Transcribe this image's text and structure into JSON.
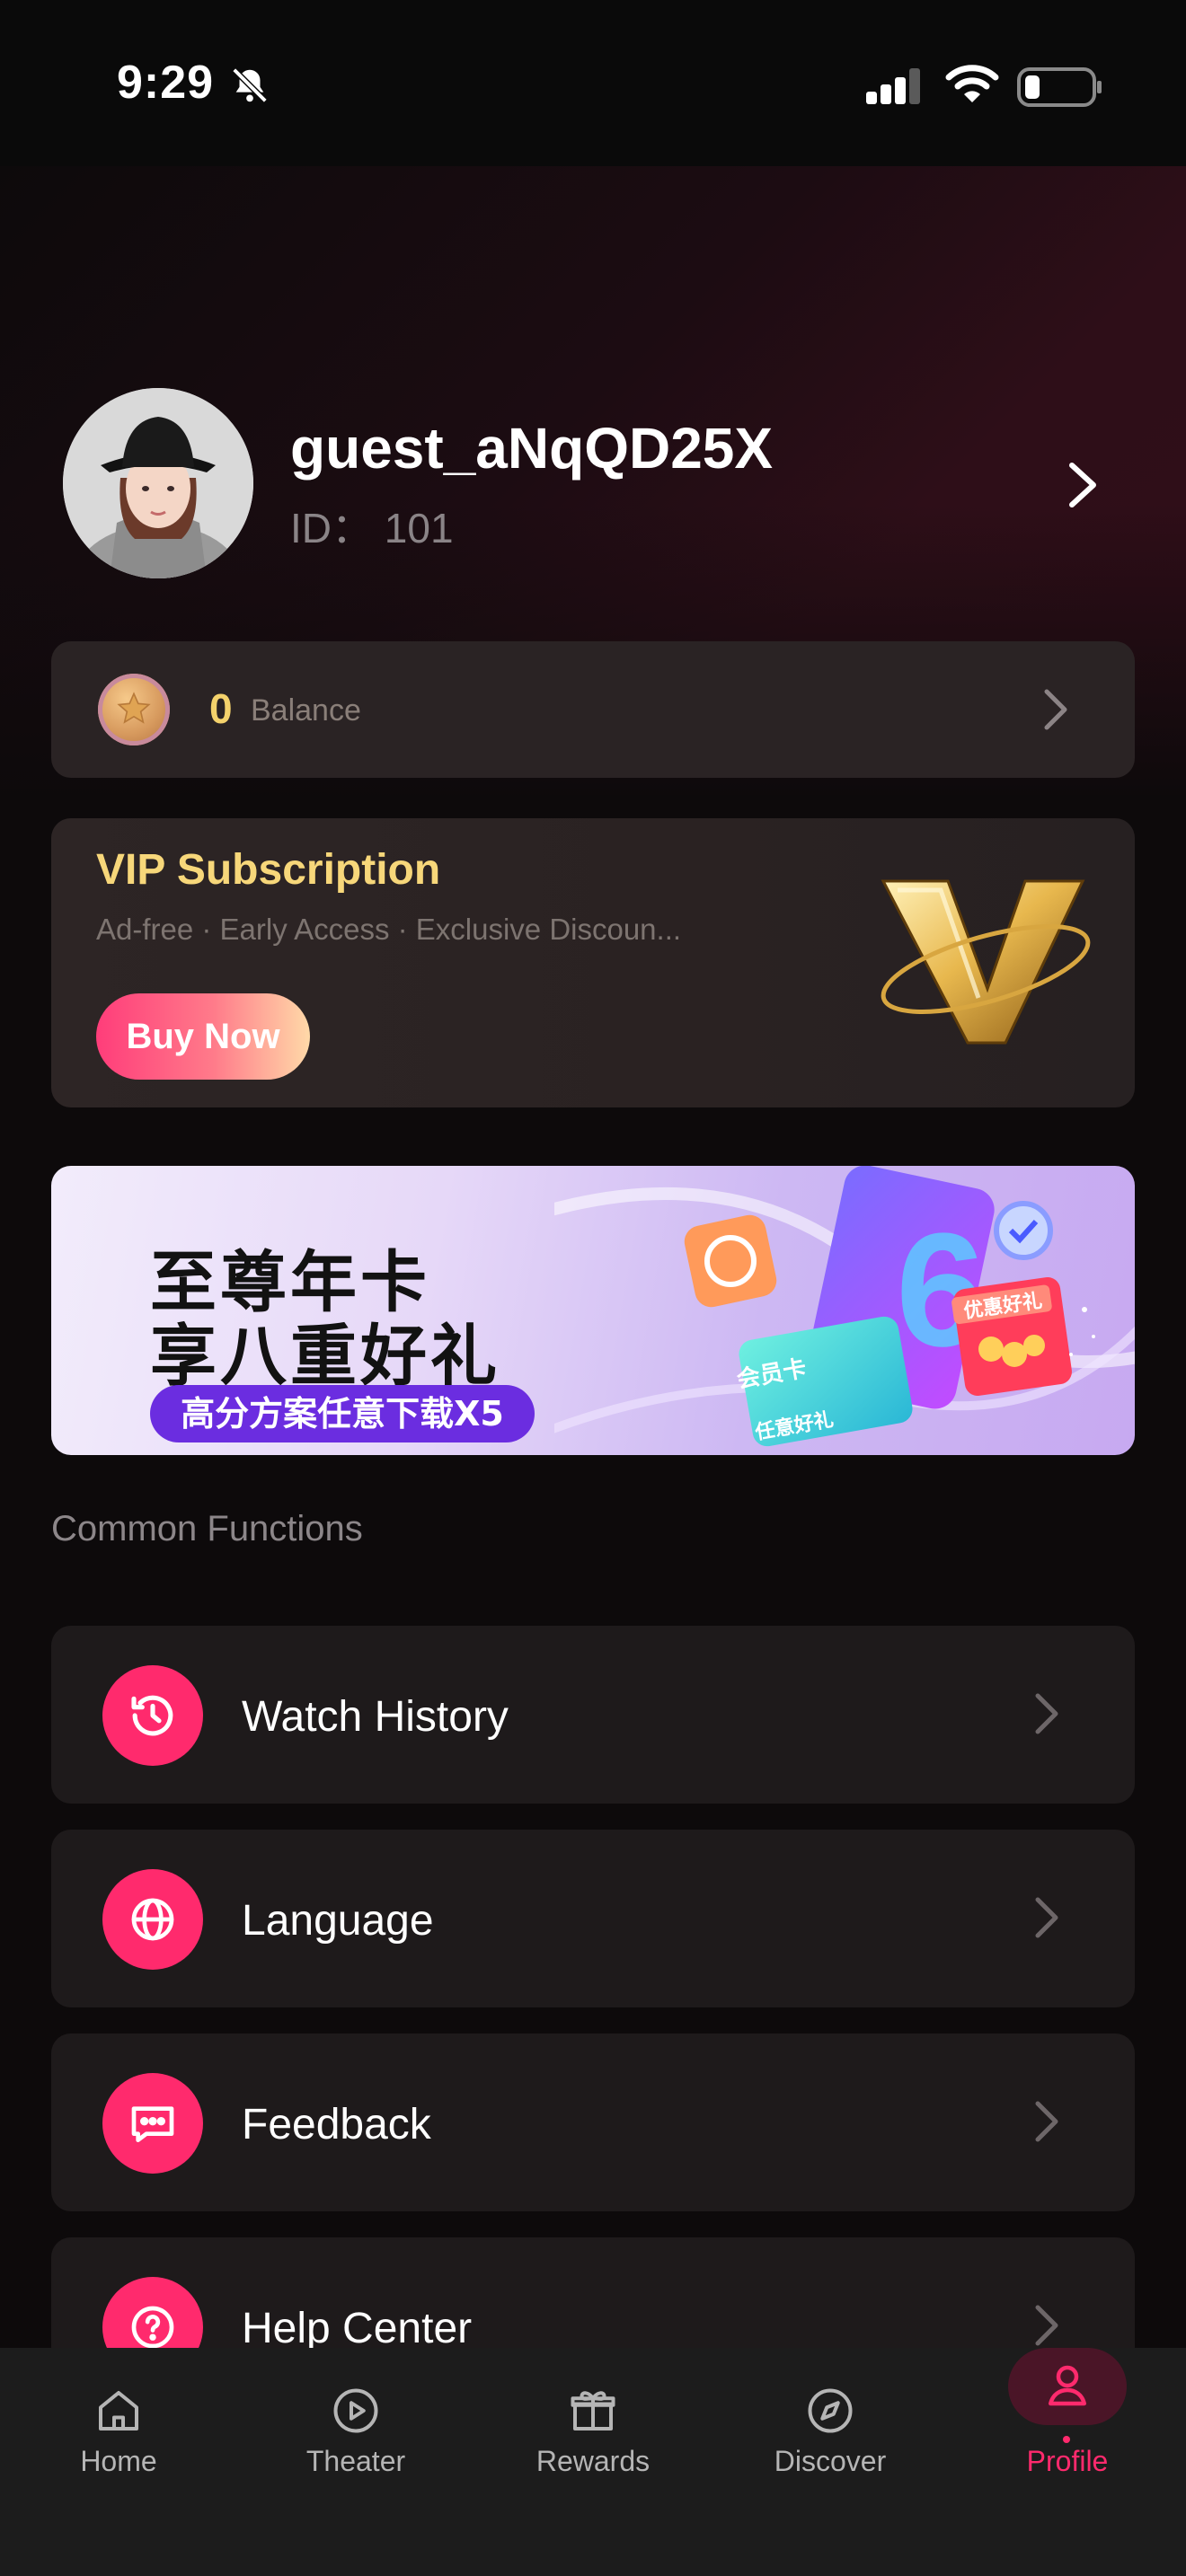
{
  "status_bar": {
    "time": "9:29"
  },
  "profile": {
    "username": "guest_aNqQD25X",
    "id_text": "ID： 101"
  },
  "balance": {
    "amount": "0",
    "label": "Balance"
  },
  "vip": {
    "title": "VIP Subscription",
    "description": "Ad-free · Early Access · Exclusive Discoun...",
    "button_label": "Buy Now"
  },
  "banner": {
    "line1": "至尊年卡",
    "line2": "享八重好礼",
    "tagline": "高分方案任意下载X5",
    "card_label": "会员卡",
    "card_sub": "任意好礼",
    "gift_label": "优惠好礼"
  },
  "section": {
    "title": "Common Functions"
  },
  "menu": [
    {
      "label": "Watch History",
      "icon": "history-icon"
    },
    {
      "label": "Language",
      "icon": "globe-icon"
    },
    {
      "label": "Feedback",
      "icon": "message-icon"
    },
    {
      "label": "Help Center",
      "icon": "help-icon"
    }
  ],
  "tabs": [
    {
      "label": "Home",
      "icon": "home-icon"
    },
    {
      "label": "Theater",
      "icon": "play-icon"
    },
    {
      "label": "Rewards",
      "icon": "gift-icon"
    },
    {
      "label": "Discover",
      "icon": "compass-icon"
    },
    {
      "label": "Profile",
      "icon": "user-icon",
      "active": true
    }
  ],
  "colors": {
    "accent": "#ff2a6d",
    "gold": "#f7d77a",
    "background": "#0d0a0b"
  }
}
